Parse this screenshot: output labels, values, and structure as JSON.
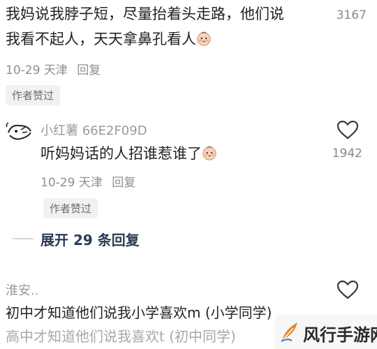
{
  "comments": [
    {
      "line1": "我妈说我脖子短，尽量抬着头走路，他们说",
      "line2": "我看不起人，天天拿鼻孔看人",
      "likes": "3167",
      "date": "10-29",
      "location": "天津",
      "reply_label": "回复",
      "badge": "作者赞过"
    }
  ],
  "reply": {
    "username": "小红薯 66E2F09D",
    "text": "听妈妈话的人招谁惹谁了",
    "likes": "1942",
    "date": "10-29",
    "location": "天津",
    "reply_label": "回复",
    "badge": "作者赞过"
  },
  "expand": {
    "label": "展开 29 条回复"
  },
  "comment3": {
    "username": "淮安..",
    "line1": "初中才知道他们说我小学喜欢m (小学同学)",
    "line2": "高中才知道他们说我喜欢t (初中同学)"
  },
  "watermark": {
    "text": "风行手游网"
  },
  "icons": {
    "like": "heart-outline-icon",
    "emoji": "blush-face-icon",
    "avatar": "sketch-avatar-icon",
    "watermark_logo": "feather-logo-icon"
  },
  "colors": {
    "text": "#222222",
    "meta": "#8f8f8f",
    "badge_bg": "#f1f1f1",
    "expand": "#2b3a55"
  }
}
